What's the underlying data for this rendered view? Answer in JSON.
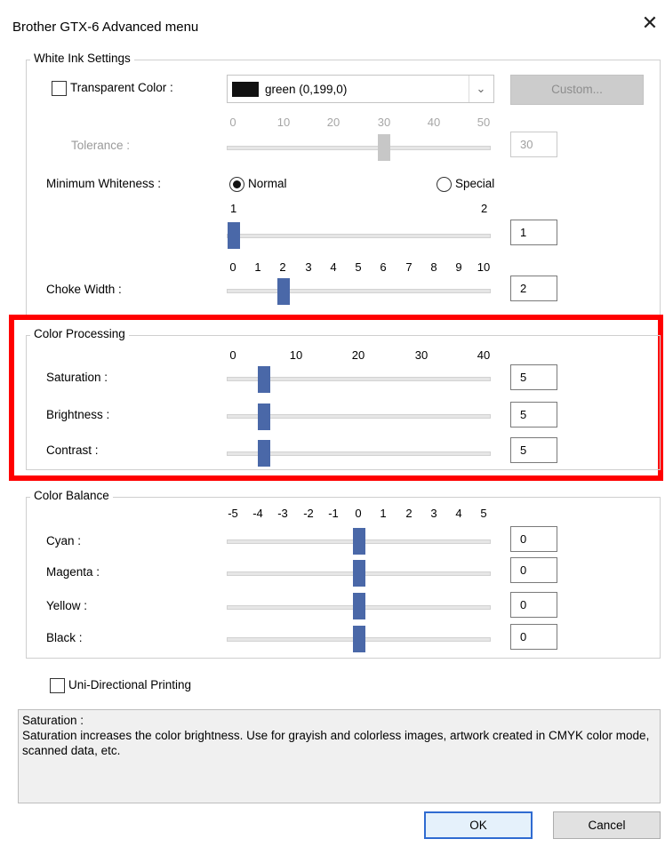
{
  "window": {
    "title": "Brother GTX-6 Advanced menu",
    "close_glyph": "✕"
  },
  "white_ink": {
    "group_title": "White Ink Settings",
    "transparent_color": {
      "label": "Transparent Color :",
      "checked": false,
      "combo_value": "green (0,199,0)",
      "custom_button": "Custom..."
    },
    "tolerance": {
      "label": "Tolerance :",
      "ticks": [
        "0",
        "10",
        "20",
        "30",
        "40",
        "50"
      ],
      "value": "30"
    },
    "minimum_whiteness": {
      "label": "Minimum Whiteness :",
      "option_normal": "Normal",
      "option_special": "Special",
      "selected": "Normal",
      "tick_min": "1",
      "tick_max": "2",
      "value": "1"
    },
    "choke_width": {
      "label": "Choke Width :",
      "ticks": [
        "0",
        "1",
        "2",
        "3",
        "4",
        "5",
        "6",
        "7",
        "8",
        "9",
        "10"
      ],
      "value": "2"
    }
  },
  "color_processing": {
    "group_title": "Color Processing",
    "ticks": [
      "0",
      "10",
      "20",
      "30",
      "40"
    ],
    "saturation": {
      "label": "Saturation :",
      "value": "5"
    },
    "brightness": {
      "label": "Brightness :",
      "value": "5"
    },
    "contrast": {
      "label": "Contrast :",
      "value": "5"
    }
  },
  "color_balance": {
    "group_title": "Color Balance",
    "ticks": [
      "-5",
      "-4",
      "-3",
      "-2",
      "-1",
      "0",
      "1",
      "2",
      "3",
      "4",
      "5"
    ],
    "cyan": {
      "label": "Cyan :",
      "value": "0"
    },
    "magenta": {
      "label": "Magenta :",
      "value": "0"
    },
    "yellow": {
      "label": "Yellow :",
      "value": "0"
    },
    "black": {
      "label": "Black :",
      "value": "0"
    }
  },
  "uni_directional": {
    "label": "Uni-Directional Printing",
    "checked": false
  },
  "description": {
    "heading": "Saturation :",
    "text": "Saturation increases the color brightness. Use for grayish and colorless images, artwork created in CMYK color mode, scanned data, etc."
  },
  "buttons": {
    "ok": "OK",
    "cancel": "Cancel"
  },
  "colors": {
    "slider_thumb": "#4a68a8",
    "highlight_border": "#ff0000",
    "default_button_border": "#2f6bd1",
    "swatch": "#111111"
  },
  "icons": {
    "close": "close-icon",
    "dropdown": "chevron-down-icon"
  }
}
